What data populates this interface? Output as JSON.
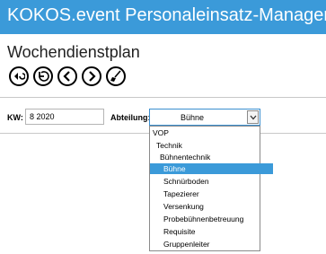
{
  "header": {
    "title": "KOKOS.event Personaleinsatz-Manager"
  },
  "page": {
    "title": "Wochendienstplan"
  },
  "toolbar": {
    "buttons": [
      {
        "name": "go-current-icon"
      },
      {
        "name": "return-icon"
      },
      {
        "name": "previous-icon"
      },
      {
        "name": "next-icon"
      },
      {
        "name": "broom-icon"
      }
    ]
  },
  "form": {
    "kw_label": "KW:",
    "kw_value": "8 2020",
    "abteilung_label": "Abteilung:",
    "abteilung_value": "Bühne"
  },
  "dropdown": {
    "options": [
      {
        "label": "VOP",
        "selected": false
      },
      {
        "label": "Technik",
        "selected": false
      },
      {
        "label": "Bühnentechnik",
        "selected": false
      },
      {
        "label": "Bühne",
        "selected": true
      },
      {
        "label": "Schnürboden",
        "selected": false
      },
      {
        "label": "Tapezierer",
        "selected": false
      },
      {
        "label": "Versenkung",
        "selected": false
      },
      {
        "label": "Probebühnenbetreuung",
        "selected": false
      },
      {
        "label": "Requisite",
        "selected": false
      },
      {
        "label": "Gruppenleiter",
        "selected": false
      }
    ]
  },
  "colors": {
    "accent": "#3b9ad9"
  }
}
